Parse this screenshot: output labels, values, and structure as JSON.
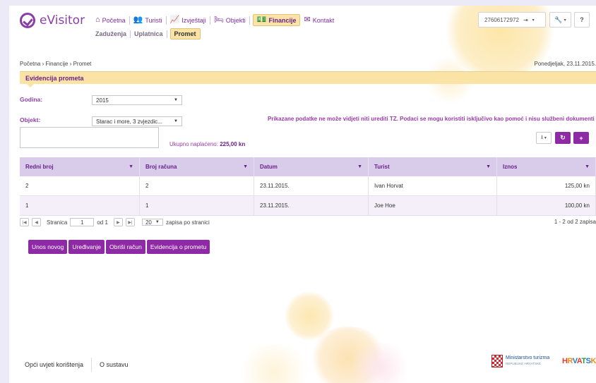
{
  "app": {
    "name": "eVisitor"
  },
  "nav": {
    "items": [
      {
        "label": "Početna"
      },
      {
        "label": "Turisti"
      },
      {
        "label": "Izvještaji"
      },
      {
        "label": "Objekti"
      },
      {
        "label": "Financije"
      },
      {
        "label": "Kontakt"
      }
    ],
    "sub": [
      {
        "label": "Zaduženja"
      },
      {
        "label": "Uplatnica"
      },
      {
        "label": "Promet"
      }
    ],
    "active_tab": "Financije",
    "active_sub": "Promet"
  },
  "user": {
    "id": "27606172972"
  },
  "breadcrumb": "Početna › Financije › Promet",
  "date": "Ponedjeljak, 23.11.2015.",
  "section": {
    "title": "Evidencija prometa"
  },
  "filters": {
    "godina_label": "Godina:",
    "godina_value": "2015",
    "objekt_label": "Objekt:",
    "objekt_value": "Starac i more, 3 zvjezdic..."
  },
  "notice": "Prikazane podatke ne može vidjeti niti urediti TZ. Podaci se mogu koristiti isključivo kao pomoć i nisu službeni dokumenti",
  "total": {
    "label": "Ukupno naplaćeno:",
    "value": "225,00 kn"
  },
  "table": {
    "columns": [
      "Redni broj",
      "Broj računa",
      "Datum",
      "Turist",
      "Iznos"
    ],
    "rows": [
      [
        "2",
        "2",
        "23.11.2015.",
        "Ivan Horvat",
        "125,00 kn"
      ],
      [
        "1",
        "1",
        "23.11.2015.",
        "Joe Hoe",
        "100,00 kn"
      ]
    ]
  },
  "pager": {
    "page_label": "Stranica",
    "page": "1",
    "of_label": "od 1",
    "page_size": "20",
    "per_page_label": "zapisa po stranici",
    "info": "1 - 2 od 2 zapisa"
  },
  "actions": [
    "Unos novog",
    "Uređivanje",
    "Obriši račun",
    "Evidencija o prometu"
  ],
  "footer": {
    "links": [
      "Opći uvjeti korištenja",
      "O sustavu"
    ]
  },
  "ministry": {
    "name": "Ministarstvo turizma",
    "sub": "REPUBLIKE HRVATSKE"
  },
  "brand_logo": "HRVATSKA",
  "colors": {
    "accent": "#8e2aa6",
    "highlight": "#fbe3a6",
    "table_header": "#d8ccea"
  }
}
